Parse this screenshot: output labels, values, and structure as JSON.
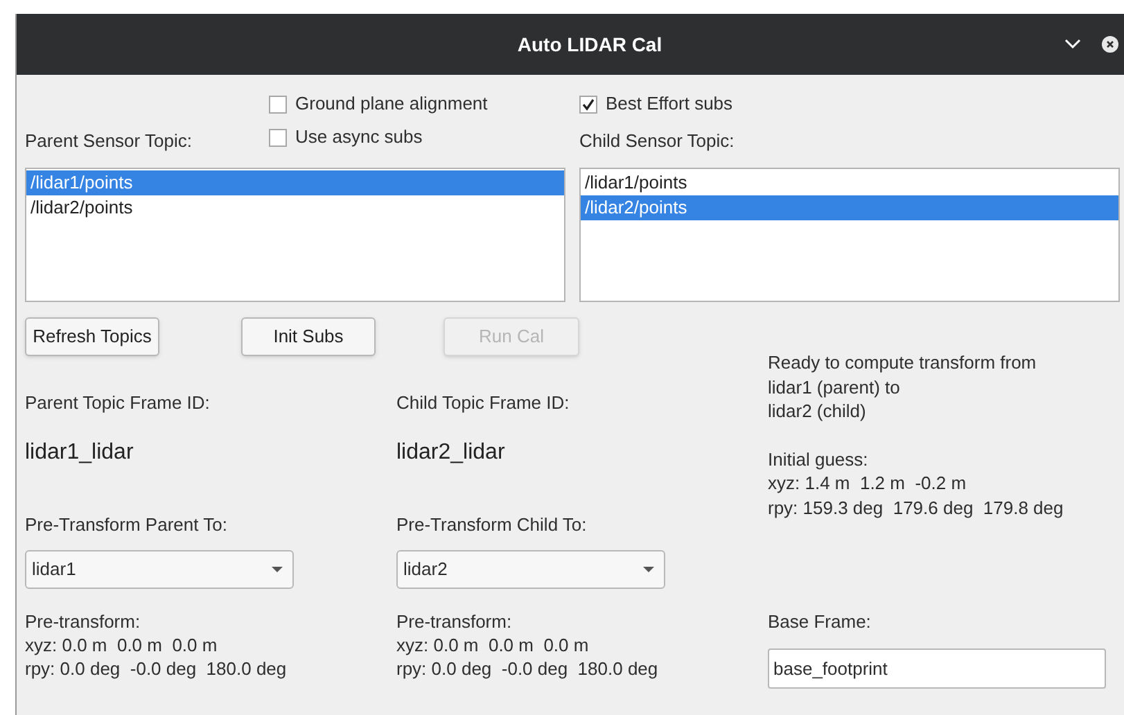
{
  "window": {
    "title": "Auto LIDAR Cal"
  },
  "options": [
    {
      "label": "Ground plane alignment",
      "checked": false
    },
    {
      "label": "Use async subs",
      "checked": false
    },
    {
      "label": "Best Effort subs",
      "checked": true
    }
  ],
  "parent_topic": {
    "label": "Parent Sensor Topic:",
    "items": [
      {
        "label": "/lidar1/points",
        "selected": true
      },
      {
        "label": "/lidar2/points",
        "selected": false
      }
    ]
  },
  "child_topic": {
    "label": "Child Sensor Topic:",
    "items": [
      {
        "label": "/lidar1/points",
        "selected": false
      },
      {
        "label": "/lidar2/points",
        "selected": true
      }
    ]
  },
  "buttons": [
    {
      "label": "Refresh Topics",
      "disabled": false
    },
    {
      "label": "Init Subs",
      "disabled": false
    },
    {
      "label": "Run Cal",
      "disabled": true
    }
  ],
  "frames": [
    {
      "label": "Parent Topic Frame ID:",
      "frame_id": "lidar1_lidar",
      "pre_label": "Pre-Transform Parent To:",
      "pre_value": "lidar1",
      "pre_lines": [
        "Pre-transform:",
        "xyz: 0.0 m  0.0 m  0.0 m",
        "rpy: 0.0 deg  -0.0 deg  180.0 deg"
      ]
    },
    {
      "label": "Child Topic Frame ID:",
      "frame_id": "lidar2_lidar",
      "pre_label": "Pre-Transform Child To:",
      "pre_value": "lidar2",
      "pre_lines": [
        "Pre-transform:",
        "xyz: 0.0 m  0.0 m  0.0 m",
        "rpy: 0.0 deg  -0.0 deg  180.0 deg"
      ]
    }
  ],
  "status": [
    "Ready to compute transform from",
    "lidar1 (parent) to",
    "lidar2 (child)"
  ],
  "initial_guess": [
    "Initial guess:",
    "xyz: 1.4 m  1.2 m  -0.2 m",
    "rpy: 159.3 deg  179.6 deg  179.8 deg"
  ],
  "base_frame": {
    "label": "Base Frame:",
    "value": "base_footprint"
  }
}
